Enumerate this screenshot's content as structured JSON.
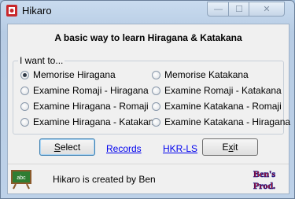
{
  "window": {
    "title": "Hikaro",
    "minimize_glyph": "—",
    "maximize_glyph": "☐",
    "close_glyph": "✕"
  },
  "heading": "A basic way to learn Hiragana & Katakana",
  "group": {
    "label": "I want to...",
    "options": [
      {
        "label": "Memorise Hiragana",
        "checked": true
      },
      {
        "label": "Memorise Katakana",
        "checked": false
      },
      {
        "label": "Examine Romaji - Hiragana",
        "checked": false
      },
      {
        "label": "Examine Romaji - Katakana",
        "checked": false
      },
      {
        "label": "Examine Hiragana - Romaji",
        "checked": false
      },
      {
        "label": "Examine Katakana - Romaji",
        "checked": false
      },
      {
        "label": "Examine Hiragana - Katakana",
        "checked": false
      },
      {
        "label": "Examine Katakana - Hiragana",
        "checked": false
      }
    ]
  },
  "buttons": {
    "select_first": "S",
    "select_rest": "elect",
    "exit_first": "E",
    "exit_underline": "x",
    "exit_rest": "it"
  },
  "links": {
    "records": "Records",
    "hkr": "HKR-LS"
  },
  "footer": {
    "credit": "Hikaro is created by Ben",
    "logo_line1": "Ben's",
    "logo_line2": "Prod.",
    "board_text": "abc"
  }
}
